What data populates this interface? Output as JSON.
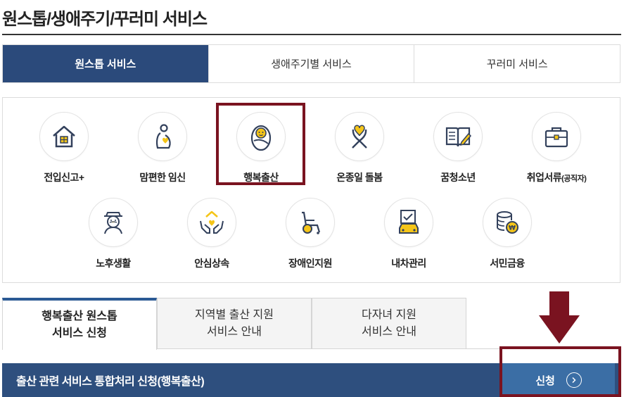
{
  "page_title": "원스톱/생애주기/꾸러미 서비스",
  "main_tabs": [
    {
      "label": "원스톱 서비스",
      "active": true
    },
    {
      "label": "생애주기별 서비스",
      "active": false
    },
    {
      "label": "꾸러미 서비스",
      "active": false
    }
  ],
  "services": [
    {
      "label": "전입신고+",
      "icon": "house-icon"
    },
    {
      "label": "맘편한 임신",
      "icon": "pregnancy-icon"
    },
    {
      "label": "행복출산",
      "icon": "baby-icon",
      "active": true
    },
    {
      "label": "온종일 돌봄",
      "icon": "ribbon-heart-icon"
    },
    {
      "label": "꿈청소년",
      "icon": "book-pen-icon"
    },
    {
      "label": "취업서류",
      "label_small": "(공직자)",
      "icon": "briefcase-icon"
    },
    {
      "label": "노후생활",
      "icon": "elderly-icon"
    },
    {
      "label": "안심상속",
      "icon": "hands-house-icon"
    },
    {
      "label": "장애인지원",
      "icon": "wheelchair-icon"
    },
    {
      "label": "내차관리",
      "icon": "car-document-icon"
    },
    {
      "label": "서민금융",
      "icon": "coins-icon"
    }
  ],
  "sub_tabs": [
    {
      "label": "행복출산 원스톱\n서비스 신청",
      "active": true
    },
    {
      "label": "지역별 출산 지원\n서비스 안내",
      "active": false
    },
    {
      "label": "다자녀 지원\n서비스 안내",
      "active": false
    }
  ],
  "apply_bar": {
    "text": "출산 관련 서비스 통합처리 신청(행복출산)",
    "button_label": "신청"
  },
  "colors": {
    "navy": "#2b4a7b",
    "bar": "#2e4f7e",
    "button": "#3b6ea5",
    "highlight": "#7a1320",
    "icon_yellow": "#f5c518",
    "icon_line": "#33415c"
  }
}
